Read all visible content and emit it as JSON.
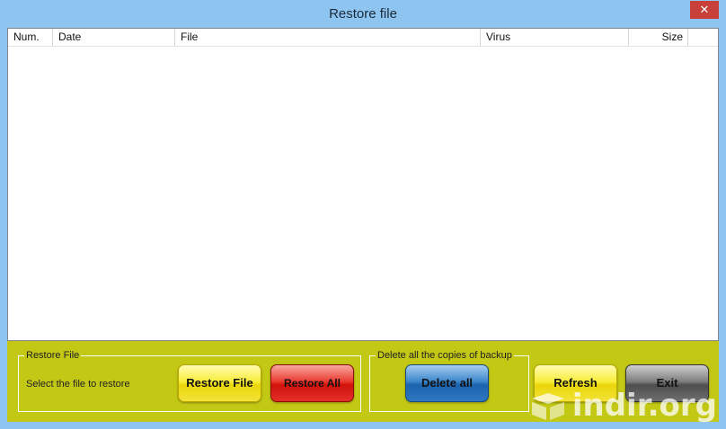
{
  "window": {
    "title": "Restore file",
    "close_glyph": "✕"
  },
  "list": {
    "columns": [
      {
        "label": "Num."
      },
      {
        "label": "Date"
      },
      {
        "label": "File"
      },
      {
        "label": "Virus"
      },
      {
        "label": "Size"
      }
    ]
  },
  "restore_group": {
    "label": "Restore File",
    "hint": "Select the file to restore",
    "restore_file_label": "Restore File",
    "restore_all_label": "Restore All"
  },
  "delete_group": {
    "label": "Delete all the copies of backup",
    "delete_all_label": "Delete all"
  },
  "refresh_label": "Refresh",
  "exit_label": "Exit",
  "watermark": {
    "text": "indir.org"
  },
  "colors": {
    "frame": "#8ec4f0",
    "panel": "#c3c815",
    "close": "#c7413a"
  }
}
